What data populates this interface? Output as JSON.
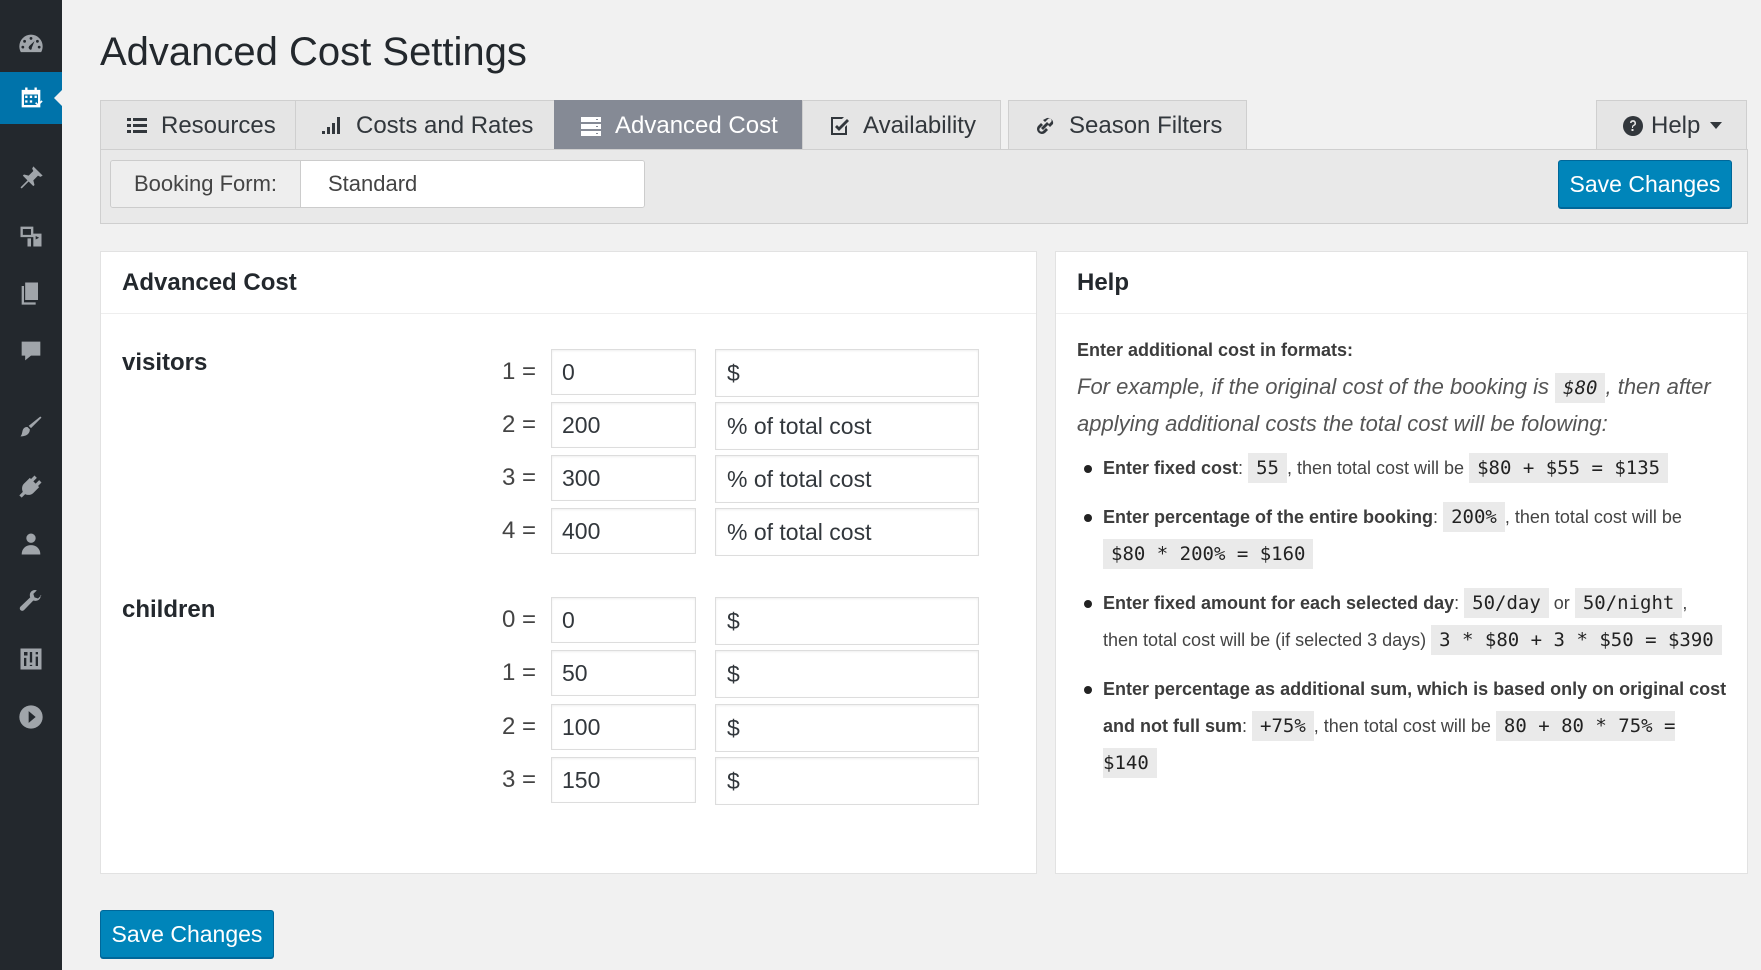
{
  "page": {
    "title": "Advanced Cost Settings"
  },
  "tabs": [
    {
      "label": "Resources",
      "icon": "list-icon",
      "active": false
    },
    {
      "label": "Costs and Rates",
      "icon": "bar-chart-icon",
      "active": false
    },
    {
      "label": "Advanced Cost",
      "icon": "server-icon",
      "active": true
    },
    {
      "label": "Availability",
      "icon": "check-square-icon",
      "active": false
    },
    {
      "label": "Season Filters",
      "icon": "link-icon",
      "active": false
    }
  ],
  "help_tab": {
    "label": "Help",
    "icon": "question-circle-icon"
  },
  "toolbar": {
    "booking_form_label": "Booking Form:",
    "booking_form_value": "Standard",
    "save_label": "Save Changes"
  },
  "advanced_cost": {
    "title": "Advanced Cost",
    "visitors": {
      "label": "visitors",
      "rows": [
        {
          "num": "1 =",
          "value": "0",
          "unit": "$"
        },
        {
          "num": "2 =",
          "value": "200",
          "unit": "% of total cost"
        },
        {
          "num": "3 =",
          "value": "300",
          "unit": "% of total cost"
        },
        {
          "num": "4 =",
          "value": "400",
          "unit": "% of total cost"
        }
      ]
    },
    "children": {
      "label": "children",
      "rows": [
        {
          "num": "0 =",
          "value": "0",
          "unit": "$"
        },
        {
          "num": "1 =",
          "value": "50",
          "unit": "$"
        },
        {
          "num": "2 =",
          "value": "100",
          "unit": "$"
        },
        {
          "num": "3 =",
          "value": "150",
          "unit": "$"
        }
      ]
    }
  },
  "help": {
    "title": "Help",
    "intro": "Enter additional cost in formats:",
    "example_pre": "For example, if the original cost of the booking is",
    "example_code": "$80",
    "example_post": ", then after applying additional costs the total cost will be folowing:",
    "items": [
      {
        "label": "Enter fixed cost",
        "code1": "55",
        "mid": ", then total cost will be",
        "code2": "$80 + $55 = $135"
      },
      {
        "label": "Enter percentage of the entire booking",
        "code1": "200%",
        "mid": ", then total cost will be",
        "code2": "$80 * 200% = $160"
      },
      {
        "label": "Enter fixed amount for each selected day",
        "code1": "50/day",
        "or": "or",
        "code1b": "50/night",
        "mid": ", then total cost will be (if selected 3 days)",
        "code2": "3 * $80 + 3 * $50 = $390"
      },
      {
        "label": "Enter percentage as additional sum, which is based only on original cost and not full sum",
        "code1": "+75%",
        "mid": ", then total cost will be",
        "code2": "80 + 80 * 75% = $140"
      }
    ]
  },
  "footer": {
    "save_label": "Save Changes"
  },
  "colors": {
    "primary": "#0085ba",
    "sidebar": "#23282d",
    "sidebar_active": "#0073aa",
    "active_tab": "#858a95"
  }
}
